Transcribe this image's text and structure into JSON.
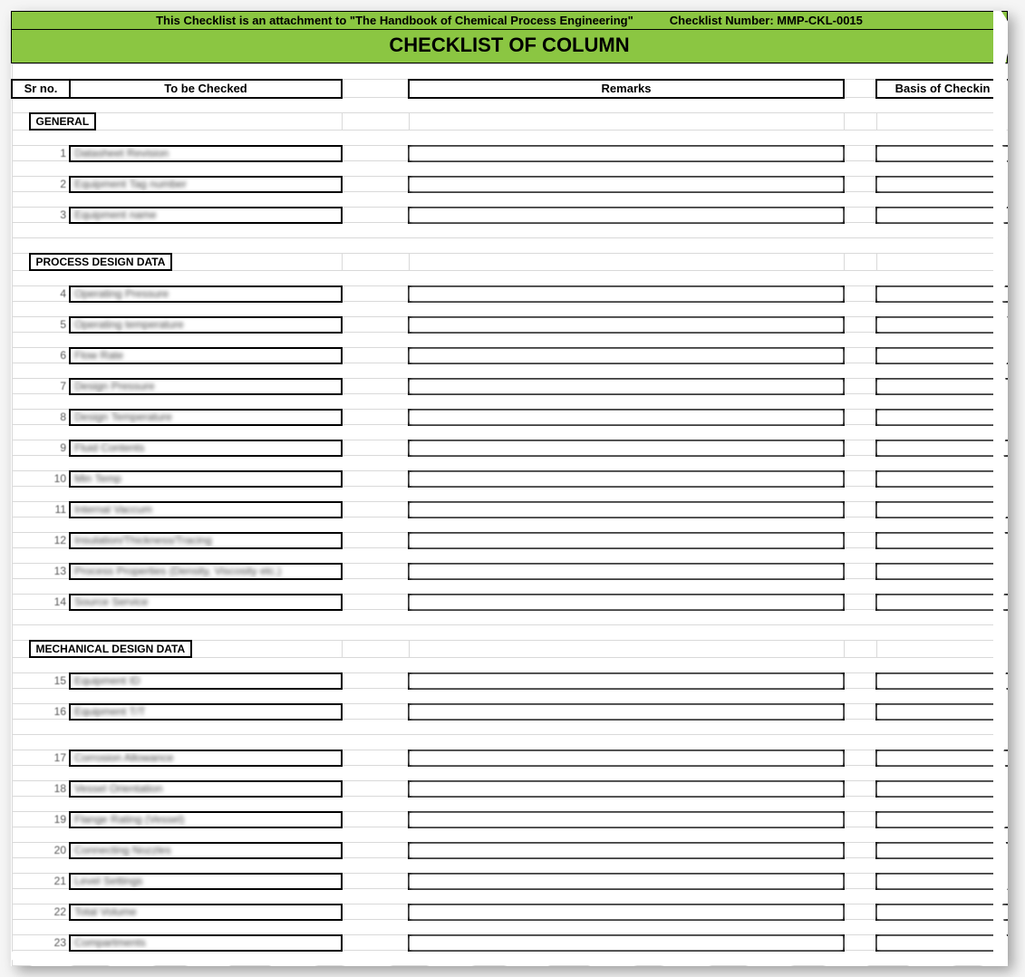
{
  "banner": {
    "attachment_text": "This Checklist is an attachment to \"The Handbook of Chemical Process Engineering\"",
    "checklist_number_label": "Checklist Number: MMP-CKL-0015"
  },
  "title": "CHECKLIST OF COLUMN",
  "headers": {
    "sr_no": "Sr no.",
    "to_be_checked": "To be Checked",
    "remarks": "Remarks",
    "basis": "Basis of Checkin"
  },
  "sections": [
    {
      "name": "GENERAL",
      "items": [
        {
          "n": 1,
          "text": "Datasheet Revision"
        },
        {
          "n": 2,
          "text": "Equipment Tag number"
        },
        {
          "n": 3,
          "text": "Equipment name"
        }
      ]
    },
    {
      "name": "PROCESS DESIGN DATA",
      "items": [
        {
          "n": 4,
          "text": "Operating Pressure"
        },
        {
          "n": 5,
          "text": "Operating temperature"
        },
        {
          "n": 6,
          "text": "Flow Rate"
        },
        {
          "n": 7,
          "text": "Design Pressure"
        },
        {
          "n": 8,
          "text": "Design Temperature"
        },
        {
          "n": 9,
          "text": "Fluid Contents"
        },
        {
          "n": 10,
          "text": "Min Temp"
        },
        {
          "n": 11,
          "text": "Internal Vaccum"
        },
        {
          "n": 12,
          "text": "Insulation/Thickness/Tracing"
        },
        {
          "n": 13,
          "text": "Process Properties (Density, Viscosity etc.)"
        },
        {
          "n": 14,
          "text": "Source Service"
        }
      ]
    },
    {
      "name": "MECHANICAL DESIGN DATA",
      "items": [
        {
          "n": 15,
          "text": "Equipment ID"
        },
        {
          "n": 16,
          "text": "Equipment T/T",
          "gap_after": true
        },
        {
          "n": 17,
          "text": "Corrosion Allowance"
        },
        {
          "n": 18,
          "text": "Vessel Orientation"
        },
        {
          "n": 19,
          "text": "Flange Rating (Vessel)"
        },
        {
          "n": 20,
          "text": "Connecting Nozzles"
        },
        {
          "n": 21,
          "text": "Level Settings"
        },
        {
          "n": 22,
          "text": "Total Volume"
        },
        {
          "n": 23,
          "text": "Compartments"
        }
      ]
    }
  ]
}
